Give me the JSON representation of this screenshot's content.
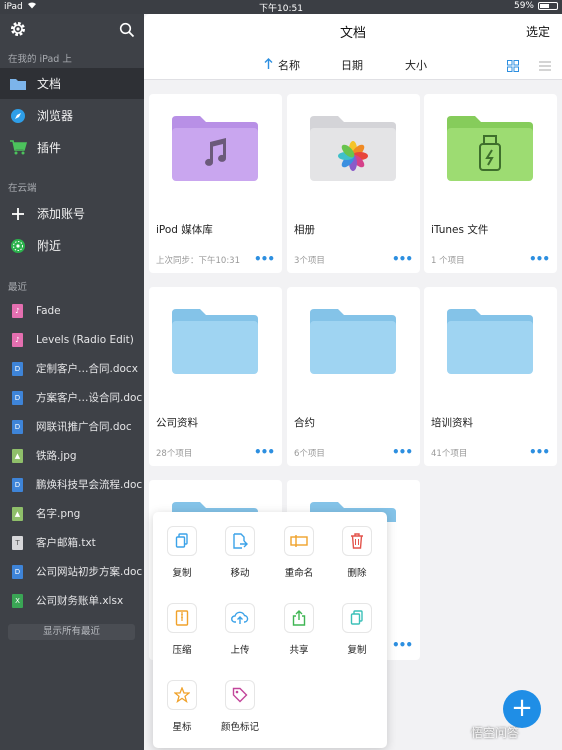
{
  "status_bar": {
    "device": "iPad",
    "time": "下午10:51",
    "battery": "59%",
    "battery_level": 0.59
  },
  "sidebar": {
    "section_local": "在我的 iPad 上",
    "local_items": [
      {
        "label": "文档",
        "icon": "folder-icon",
        "active": true
      },
      {
        "label": "浏览器",
        "icon": "compass-icon"
      },
      {
        "label": "插件",
        "icon": "cart-icon"
      }
    ],
    "section_cloud": "在云端",
    "cloud_items": [
      {
        "label": "添加账号",
        "icon": "plus-icon"
      },
      {
        "label": "附近",
        "icon": "nearby-icon"
      }
    ],
    "section_recent": "最近",
    "recent_items": [
      {
        "label": "Fade",
        "icon": "music-file-icon"
      },
      {
        "label": "Levels (Radio Edit)",
        "icon": "music-file-icon"
      },
      {
        "label": "定制客户…合同.docx",
        "icon": "doc-file-icon"
      },
      {
        "label": "方案客户…设合同.doc",
        "icon": "doc-file-icon"
      },
      {
        "label": "网联讯推广合同.doc",
        "icon": "doc-file-icon"
      },
      {
        "label": "铁路.jpg",
        "icon": "image-file-icon"
      },
      {
        "label": "鹏焕科技早会流程.doc",
        "icon": "doc-file-icon"
      },
      {
        "label": "名字.png",
        "icon": "image-file-icon"
      },
      {
        "label": "客户邮箱.txt",
        "icon": "txt-file-icon"
      },
      {
        "label": "公司网站初步方案.doc",
        "icon": "doc-file-icon"
      },
      {
        "label": "公司财务账单.xlsx",
        "icon": "xls-file-icon"
      }
    ],
    "show_all": "显示所有最近"
  },
  "main": {
    "title": "文档",
    "select": "选定",
    "sort": {
      "name": "名称",
      "date": "日期",
      "size": "大小"
    },
    "cards": [
      {
        "name": "iPod 媒体库",
        "meta": "上次同步：下午10:31",
        "folder_color": "#c9a6ef",
        "folder_tab": "#b890e6",
        "emblem": "music"
      },
      {
        "name": "相册",
        "meta": "3个项目",
        "folder_color": "#e4e4e6",
        "folder_tab": "#d4d4d8",
        "emblem": "photos"
      },
      {
        "name": "iTunes 文件",
        "meta": "1 个项目",
        "folder_color": "#9ddc72",
        "folder_tab": "#86cc5b",
        "emblem": "usb"
      },
      {
        "name": "公司资料",
        "meta": "28个项目",
        "folder_color": "#9fd4f2",
        "folder_tab": "#84c3e8",
        "emblem": ""
      },
      {
        "name": "合约",
        "meta": "6个项目",
        "folder_color": "#9fd4f2",
        "folder_tab": "#84c3e8",
        "emblem": ""
      },
      {
        "name": "培训资料",
        "meta": "41个项目",
        "folder_color": "#9fd4f2",
        "folder_tab": "#84c3e8",
        "emblem": ""
      }
    ]
  },
  "popover": {
    "items": [
      {
        "label": "复制",
        "icon": "copy-icon"
      },
      {
        "label": "移动",
        "icon": "move-icon"
      },
      {
        "label": "重命名",
        "icon": "rename-icon"
      },
      {
        "label": "删除",
        "icon": "trash-icon"
      },
      {
        "label": "压缩",
        "icon": "zip-icon"
      },
      {
        "label": "上传",
        "icon": "upload-icon"
      },
      {
        "label": "共享",
        "icon": "share-icon"
      },
      {
        "label": "复制",
        "icon": "duplicate-icon"
      },
      {
        "label": "星标",
        "icon": "star-icon"
      },
      {
        "label": "颜色标记",
        "icon": "tag-icon"
      }
    ]
  },
  "fab_label": "+",
  "watermark": "悟空问答",
  "colors": {
    "accent": "#1f8ee6",
    "sidebar": "#3e4147",
    "sidebar_active": "#2e3035"
  }
}
